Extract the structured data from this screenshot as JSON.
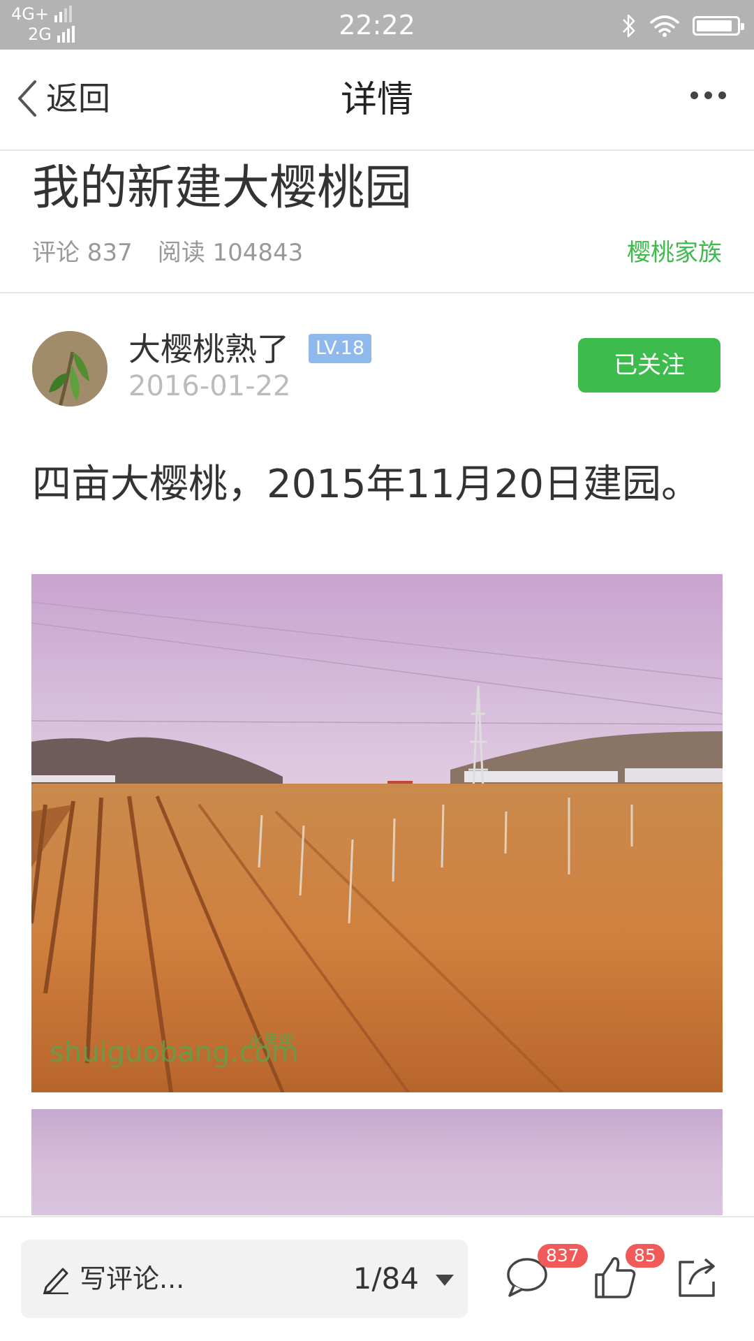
{
  "status_bar": {
    "network_top": "4G+",
    "network_bottom": "2G",
    "time": "22:22",
    "battery_level": 0.9
  },
  "nav": {
    "back_label": "返回",
    "title": "详情"
  },
  "post": {
    "title": "我的新建大樱桃园",
    "comments_label": "评论 837",
    "reads_label": "阅读 104843",
    "circle": "樱桃家族",
    "content": "四亩大樱桃，2015年11月20日建园。"
  },
  "author": {
    "name": "大樱桃熟了",
    "level": "LV.18",
    "date": "2016-01-22",
    "follow_label": "已关注"
  },
  "photo1": {
    "watermark": "shuiguobang.com",
    "watermark_cn": "水果帮"
  },
  "bottom_bar": {
    "comment_placeholder": "写评论...",
    "pager": "1/84",
    "comment_count": "837",
    "like_count": "85"
  },
  "colors": {
    "accent_green": "#3dbb4c",
    "level_badge": "#8fb8ec",
    "count_badge": "#f25a5a",
    "status_bar": "#b3b3b3"
  },
  "icons": [
    "back-chevron-icon",
    "more-icon",
    "bluetooth-icon",
    "wifi-icon",
    "battery-icon",
    "pen-icon",
    "comment-icon",
    "like-icon",
    "share-icon"
  ]
}
